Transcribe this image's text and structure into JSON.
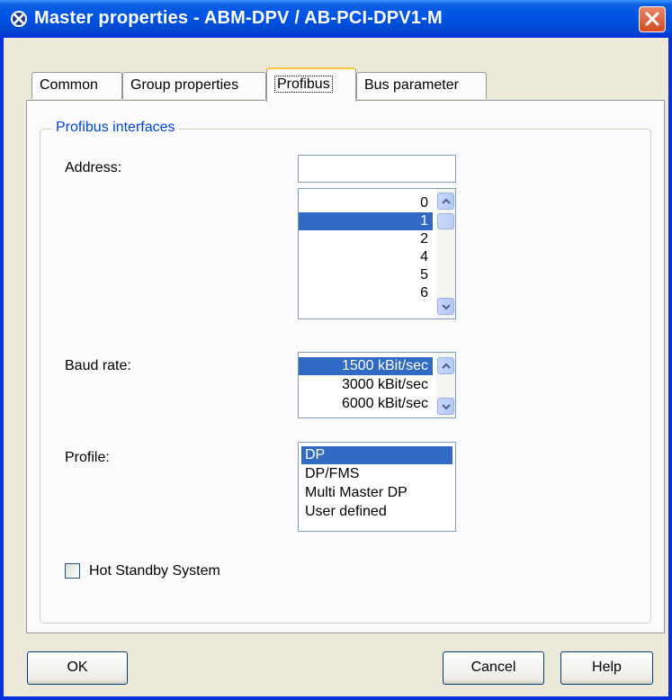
{
  "window": {
    "title": "Master properties - ABM-DPV / AB-PCI-DPV1-M"
  },
  "tabs": [
    {
      "label": "Common"
    },
    {
      "label": "Group properties"
    },
    {
      "label": "Profibus"
    },
    {
      "label": "Bus parameter"
    }
  ],
  "group": {
    "legend": "Profibus interfaces"
  },
  "address": {
    "label": "Address:",
    "value": "",
    "options": [
      "0",
      "1",
      "2",
      "4",
      "5",
      "6"
    ],
    "selected": "1"
  },
  "baud_rate": {
    "label": "Baud rate:",
    "options": [
      "1500 kBit/sec",
      "3000 kBit/sec",
      "6000 kBit/sec"
    ],
    "selected": "1500 kBit/sec"
  },
  "profile": {
    "label": "Profile:",
    "options": [
      "DP",
      "DP/FMS",
      "Multi Master DP",
      "User defined"
    ],
    "selected": "DP"
  },
  "hot_standby": {
    "label": "Hot Standby System",
    "checked": false
  },
  "buttons": {
    "ok": "OK",
    "cancel": "Cancel",
    "help": "Help"
  },
  "colors": {
    "selection": "#316AC5",
    "titlebar": "#0055E5",
    "group_legend": "#0046D5"
  }
}
